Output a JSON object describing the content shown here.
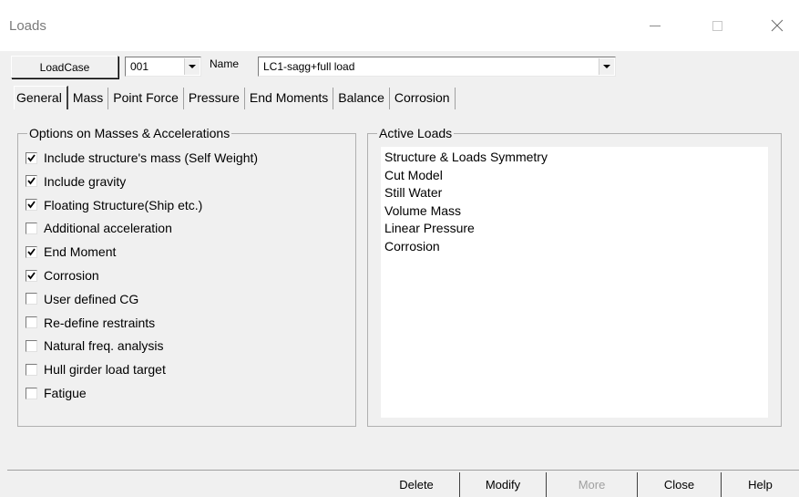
{
  "window": {
    "title": "Loads"
  },
  "loadcase": {
    "button_label": "LoadCase",
    "number": "001",
    "name_label": "Name",
    "name_value": "LC1-sagg+full load"
  },
  "tabs": [
    "General",
    "Mass",
    "Point Force",
    "Pressure",
    "End Moments",
    "Balance",
    "Corrosion"
  ],
  "options_group": {
    "title": "Options on Masses & Accelerations",
    "items": [
      {
        "label": "Include structure's mass (Self Weight)",
        "checked": true
      },
      {
        "label": "Include gravity",
        "checked": true
      },
      {
        "label": "Floating Structure(Ship etc.)",
        "checked": true
      },
      {
        "label": "Additional acceleration",
        "checked": false
      },
      {
        "label": "End Moment",
        "checked": true
      },
      {
        "label": "Corrosion",
        "checked": true
      },
      {
        "label": "User defined CG",
        "checked": false
      },
      {
        "label": "Re-define restraints",
        "checked": false
      },
      {
        "label": "Natural freq. analysis",
        "checked": false
      },
      {
        "label": "Hull girder load target",
        "checked": false
      },
      {
        "label": "Fatigue",
        "checked": false
      }
    ]
  },
  "active_loads": {
    "title": "Active Loads",
    "items": [
      "Structure & Loads Symmetry",
      "Cut Model",
      "Still Water",
      "Volume Mass",
      "Linear Pressure",
      "Corrosion"
    ]
  },
  "bottom_buttons": {
    "delete": "Delete",
    "modify": "Modify",
    "more": "More",
    "close": "Close",
    "help": "Help"
  }
}
